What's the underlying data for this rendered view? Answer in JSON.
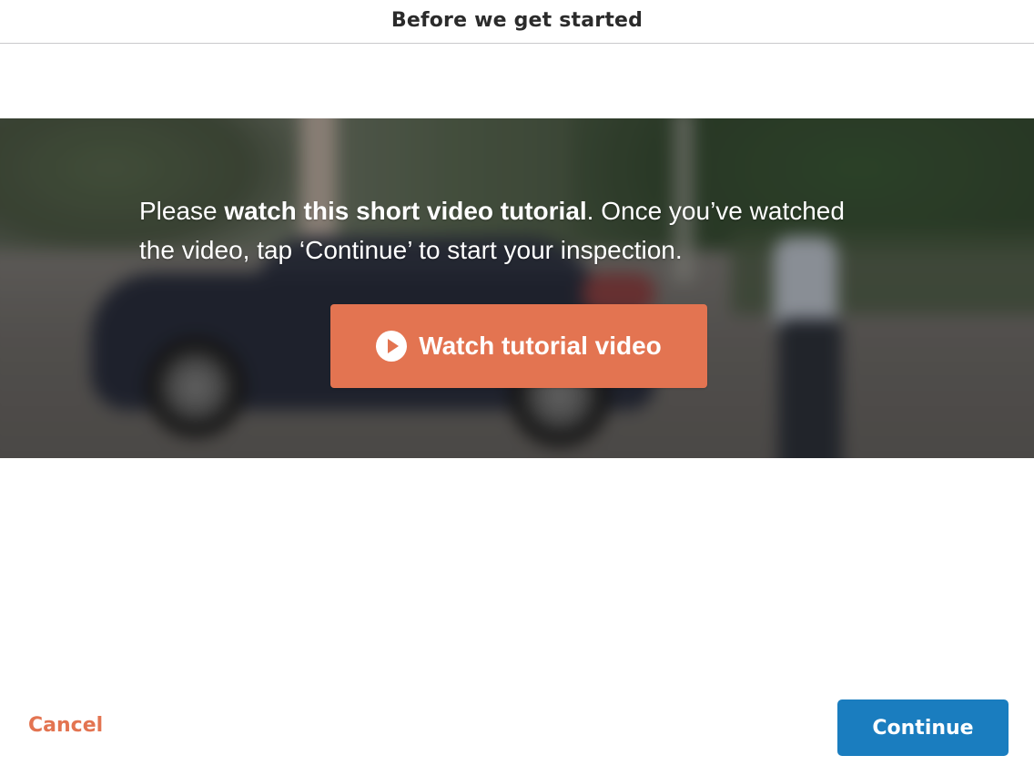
{
  "header": {
    "title": "Before we get started"
  },
  "banner": {
    "text_before": "Please ",
    "text_bold": "watch this short video tutorial",
    "text_after": ". Once you’ve watched the video, tap ‘Continue’ to start your inspection.",
    "watch_button": {
      "label": "Watch tutorial video",
      "icon": "play-circle-icon"
    },
    "background_image": "blurred-car-street-photo"
  },
  "footer": {
    "cancel_label": "Cancel",
    "continue_label": "Continue"
  },
  "colors": {
    "accent_orange": "#e37451",
    "primary_blue": "#1a7dbf",
    "header_text": "#2b2b2b",
    "divider": "#c9c9cc"
  }
}
